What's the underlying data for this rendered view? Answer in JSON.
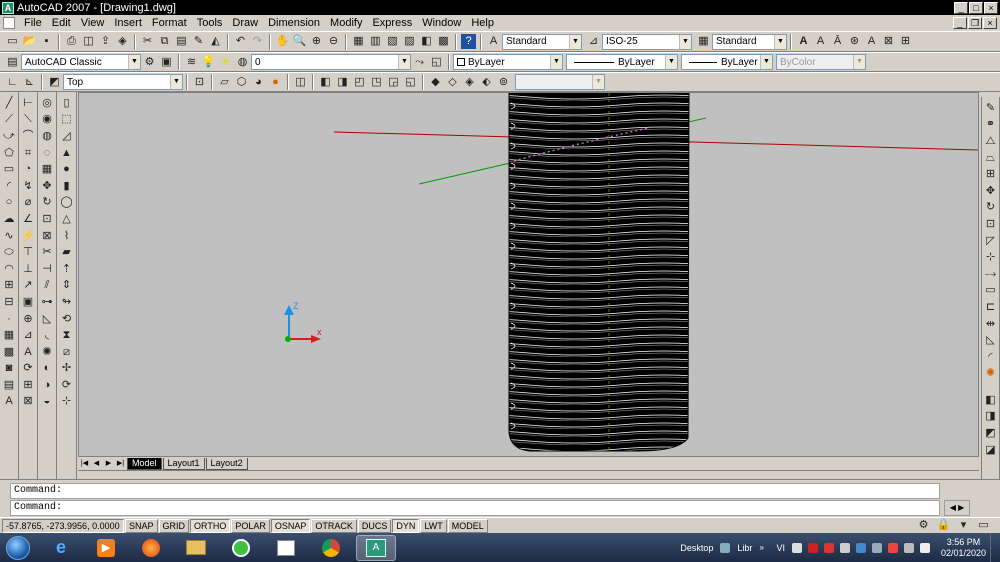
{
  "window": {
    "title": "AutoCAD 2007 - [Drawing1.dwg]"
  },
  "menus": [
    "File",
    "Edit",
    "View",
    "Insert",
    "Format",
    "Tools",
    "Draw",
    "Dimension",
    "Modify",
    "Express",
    "Window",
    "Help"
  ],
  "toolbar_styles": {
    "text_style": "Standard",
    "dim_style": "ISO-25",
    "table_style": "Standard"
  },
  "workspace": {
    "name": "AutoCAD Classic"
  },
  "layer": {
    "current": "0"
  },
  "properties": {
    "color": "ByLayer",
    "linetype": "ByLayer",
    "lineweight": "ByLayer",
    "plotstyle": "ByColor"
  },
  "views": {
    "current": "Top"
  },
  "layout_tabs": [
    "Model",
    "Layout1",
    "Layout2"
  ],
  "command": {
    "prompt1": "Command:",
    "prompt2": "Command:"
  },
  "status": {
    "coords": "-57.8765, -273.9956, 0.0000",
    "buttons": [
      "SNAP",
      "GRID",
      "ORTHO",
      "POLAR",
      "OSNAP",
      "OTRACK",
      "DUCS",
      "DYN",
      "LWT",
      "MODEL"
    ],
    "active": [
      "ORTHO",
      "OSNAP",
      "DYN"
    ]
  },
  "ucs": {
    "x_label": "x",
    "z_label": "Z"
  },
  "taskbar": {
    "desktop_label": "Desktop",
    "libr_label": "Libr",
    "vi_label": "VI",
    "time": "3:56 PM",
    "date": "02/01/2020"
  },
  "colors": {
    "x_axis": "#b00000",
    "y_axis": "#00a000",
    "viewport_bg": "#c0c0c0"
  }
}
